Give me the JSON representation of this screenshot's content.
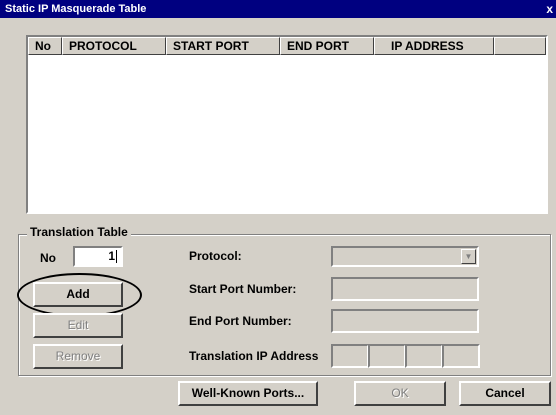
{
  "window": {
    "title": "Static IP Masquerade Table",
    "close_glyph": "x"
  },
  "table": {
    "columns": [
      "No",
      "PROTOCOL",
      "START PORT",
      "END PORT",
      "IP ADDRESS",
      ""
    ],
    "rows": []
  },
  "translation": {
    "group_label": "Translation Table",
    "no_label": "No",
    "no_value": "1",
    "add_label": "Add",
    "edit_label": "Edit",
    "remove_label": "Remove",
    "protocol_label": "Protocol:",
    "protocol_value": "",
    "start_port_label": "Start Port Number:",
    "end_port_label": "End Port Number:",
    "ip_label": "Translation IP Address"
  },
  "footer": {
    "well_known_label": "Well-Known Ports...",
    "ok_label": "OK",
    "cancel_label": "Cancel"
  },
  "icons": {
    "dropdown": "chevron-down-icon",
    "close": "close-icon"
  }
}
